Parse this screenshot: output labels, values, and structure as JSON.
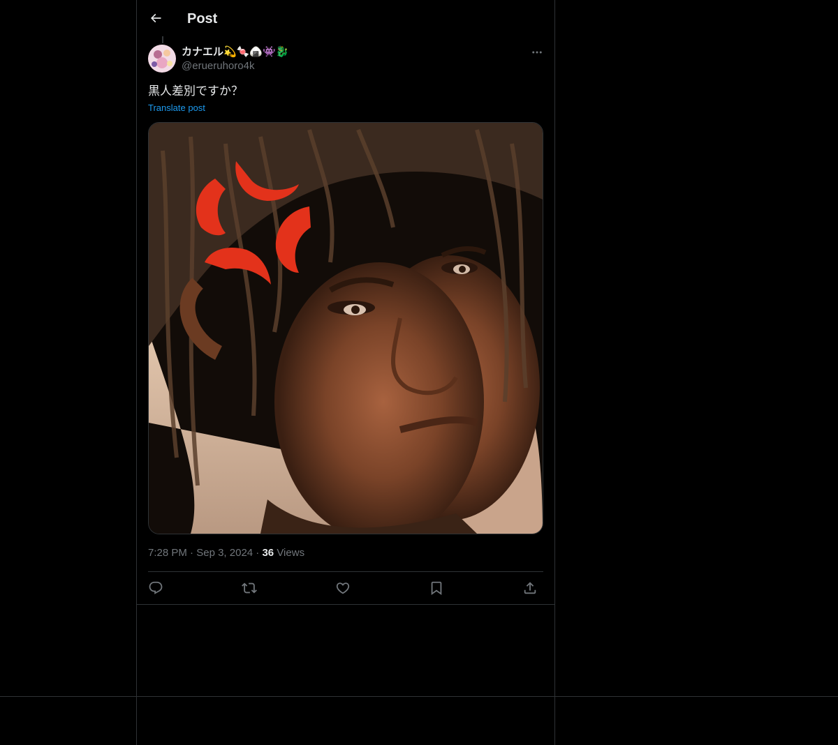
{
  "header": {
    "title": "Post",
    "back_icon": "arrow-left-icon"
  },
  "post": {
    "author": {
      "display_name": "カナエル💫🍬🍙👾🐉",
      "handle": "@erueruhoro4k",
      "avatar_icon": "avatar-image"
    },
    "text": "黒人差別ですか？",
    "translate_label": "Translate post",
    "media": {
      "kind": "photo",
      "subject": "portrait with anger-vein emoji"
    },
    "time": "7:28 PM",
    "separator": "·",
    "date": "Sep 3, 2024",
    "views_count": "36",
    "views_label": "Views"
  },
  "actions": [
    {
      "name": "reply",
      "icon": "reply-icon"
    },
    {
      "name": "repost",
      "icon": "repost-icon"
    },
    {
      "name": "like",
      "icon": "heart-icon"
    },
    {
      "name": "bookmark",
      "icon": "bookmark-icon"
    },
    {
      "name": "share",
      "icon": "share-icon"
    }
  ],
  "colors": {
    "background": "#000000",
    "text_primary": "#e7e9ea",
    "text_secondary": "#71767b",
    "accent": "#1d9bf0",
    "border": "#2f3336",
    "anger_mark": "#e3321b"
  }
}
